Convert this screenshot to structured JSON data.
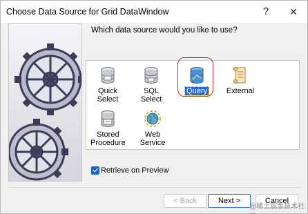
{
  "window": {
    "title": "Choose Data Source for Grid DataWindow",
    "help_glyph": "?",
    "close_glyph": "✕"
  },
  "prompt": "Which data source would you like to use?",
  "data_sources": [
    {
      "label": "Quick Select",
      "icon": "database-cylinder-icon",
      "selected": false
    },
    {
      "label": "SQL Select",
      "icon": "database-stack-icon",
      "selected": false
    },
    {
      "label": "Query",
      "icon": "query-database-icon",
      "selected": true
    },
    {
      "label": "External",
      "icon": "scroll-icon",
      "selected": false
    },
    {
      "label": "Stored Procedure",
      "icon": "stored-procedure-icon",
      "selected": false
    },
    {
      "label": "Web Service",
      "icon": "web-service-globe-icon",
      "selected": false
    }
  ],
  "retrieve": {
    "label": "Retrieve on Preview",
    "checked": true
  },
  "buttons": {
    "back": "< Back",
    "next": "Next >",
    "cancel": "Cancel"
  },
  "watermark": "@稀土掘金技术社区",
  "colors": {
    "selection": "#2a6ad6",
    "highlight_ring": "#d6252b",
    "default_button": "#2b73d4"
  }
}
